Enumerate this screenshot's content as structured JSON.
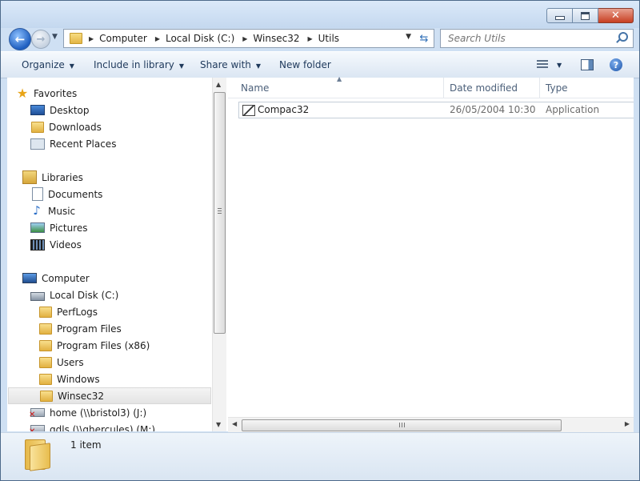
{
  "window": {
    "caption_buttons": [
      "minimize",
      "maximize",
      "close"
    ]
  },
  "address_bar": {
    "breadcrumbs": [
      "Computer",
      "Local Disk (C:)",
      "Winsec32",
      "Utils"
    ]
  },
  "search": {
    "placeholder": "Search Utils"
  },
  "toolbar": {
    "organize": "Organize",
    "include_in_library": "Include in library",
    "share_with": "Share with",
    "new_folder": "New folder"
  },
  "nav": {
    "items": [
      {
        "label": "Favorites",
        "icon": "star-icon"
      },
      {
        "label": "Desktop",
        "icon": "desktop-icon"
      },
      {
        "label": "Downloads",
        "icon": "folder-icon"
      },
      {
        "label": "Recent Places",
        "icon": "recent-places-icon"
      },
      {
        "label": "Libraries",
        "icon": "library-icon"
      },
      {
        "label": "Documents",
        "icon": "document-icon"
      },
      {
        "label": "Music",
        "icon": "music-icon"
      },
      {
        "label": "Pictures",
        "icon": "pictures-icon"
      },
      {
        "label": "Videos",
        "icon": "videos-icon"
      },
      {
        "label": "Computer",
        "icon": "computer-icon"
      },
      {
        "label": "Local Disk (C:)",
        "icon": "disk-icon"
      },
      {
        "label": "PerfLogs",
        "icon": "folder-icon"
      },
      {
        "label": "Program Files",
        "icon": "folder-icon"
      },
      {
        "label": "Program Files (x86)",
        "icon": "folder-icon"
      },
      {
        "label": "Users",
        "icon": "folder-icon"
      },
      {
        "label": "Windows",
        "icon": "folder-icon"
      },
      {
        "label": "Winsec32",
        "icon": "folder-icon",
        "selected": true
      },
      {
        "label": "home (\\\\bristol3) (J:)",
        "icon": "network-drive-disconnected-icon"
      },
      {
        "label": "qdls (\\\\ghercules) (M:)",
        "icon": "network-drive-disconnected-icon"
      }
    ]
  },
  "file_list": {
    "columns": [
      "Name",
      "Date modified",
      "Type"
    ],
    "rows": [
      {
        "name": "Compac32",
        "date_modified": "26/05/2004 10:30",
        "type": "Application",
        "icon": "application-icon"
      }
    ]
  },
  "details_pane": {
    "item_count": "1 item"
  }
}
